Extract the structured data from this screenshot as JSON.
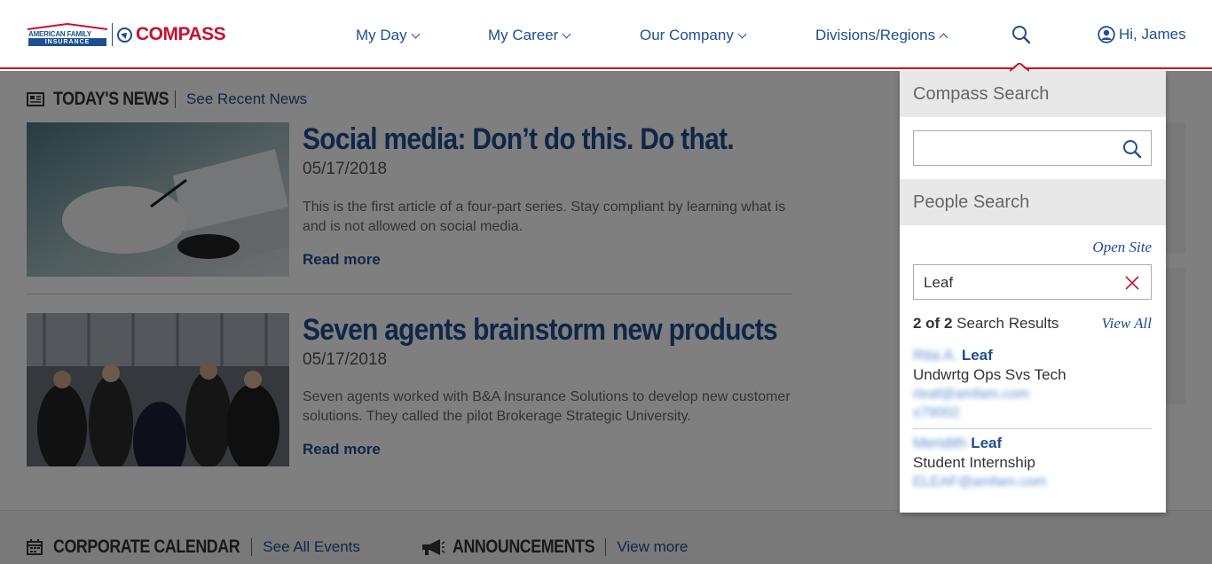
{
  "brand": {
    "afi_line1": "AMERICAN FAMILY",
    "afi_line2": "INSURANCE",
    "app_name": "COMPASS",
    "colors": {
      "primary_blue": "#1d4f91",
      "brand_red": "#c8102e"
    }
  },
  "nav": {
    "items": [
      {
        "label": "My Day",
        "icon": "chevron-down-icon"
      },
      {
        "label": "My Career",
        "icon": "chevron-down-icon"
      },
      {
        "label": "Our Company",
        "icon": "chevron-down-icon"
      },
      {
        "label": "Divisions/Regions",
        "icon": "chevron-up-icon"
      }
    ],
    "search_icon": "search-icon",
    "user_greeting": "Hi, James",
    "user_icon": "user-circle-icon"
  },
  "news": {
    "section_title": "TODAY'S NEWS",
    "section_link": "See Recent News",
    "articles": [
      {
        "title": "Social media: Don’t do this. Do that.",
        "date": "05/17/2018",
        "description": "This is the first article of a four-part series. Stay compliant by learning what is and is not allowed on social media.",
        "more": "Read more"
      },
      {
        "title": "Seven agents brainstorm new products",
        "date": "05/17/2018",
        "description": "Seven agents worked with B&A Insurance Solutions to develop new customer solutions. They called the pilot Brokerage Strategic University.",
        "more": "Read more"
      }
    ]
  },
  "calendar": {
    "section_title": "CORPORATE CALENDAR",
    "section_link": "See All Events"
  },
  "announcements": {
    "section_title": "ANNOUNCEMENTS",
    "section_link": "View more"
  },
  "search_panel": {
    "compass_search": {
      "heading": "Compass Search",
      "value": ""
    },
    "people_search": {
      "heading": "People Search",
      "open_site": "Open Site",
      "value": "Leaf",
      "result_count": "2 of 2",
      "result_label": "Search Results",
      "view_all": "View All",
      "results": [
        {
          "first_name": "Rita A.",
          "last_name": "Leaf",
          "title": "Undwrtg Ops Svs Tech",
          "email": "rleaf@amfam.com",
          "phone": "x79002"
        },
        {
          "first_name": "Meridith",
          "last_name": "Leaf",
          "title": "Student Internship",
          "email": "ELEAF@amfam.com"
        }
      ]
    }
  }
}
